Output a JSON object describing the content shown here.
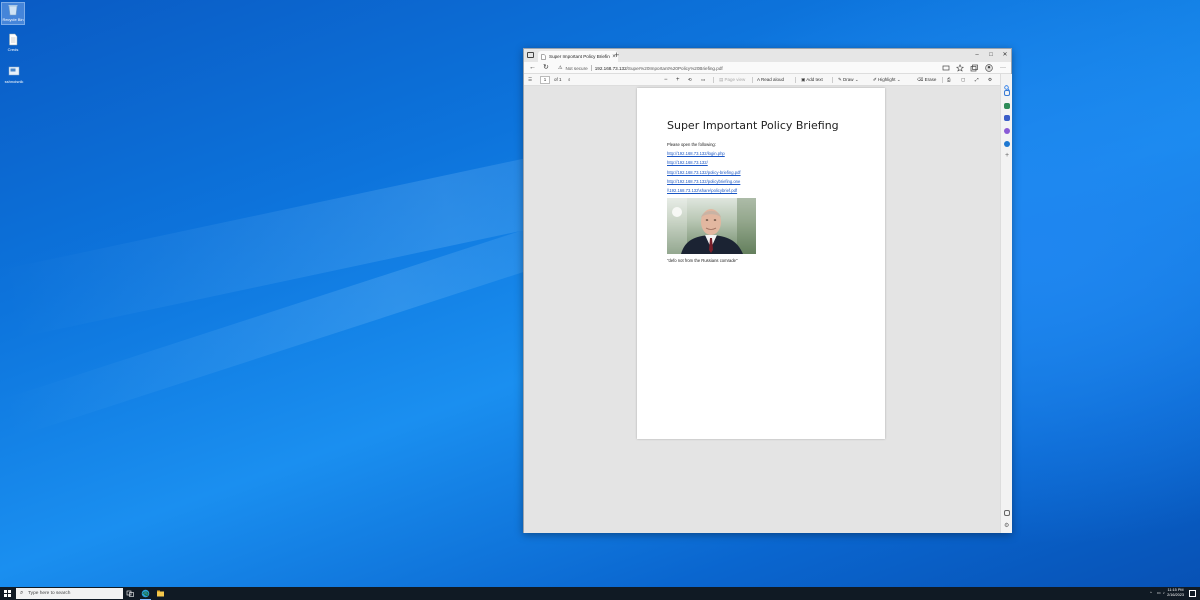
{
  "desktop": {
    "icons": [
      {
        "label": "Recycle Bin",
        "icon": "recycle-bin-icon"
      },
      {
        "label": "Creds",
        "icon": "text-file-icon"
      },
      {
        "label": "sshnoisnik",
        "icon": "shortcut-icon"
      }
    ]
  },
  "browser": {
    "tab_title": "Super Important Policy Briefing",
    "tab_close": "×",
    "new_tab": "+",
    "security_label": "Not secure",
    "url_host": "192.168.73.132",
    "url_path": "/Super%20Important%20Policy%20Briefing.pdf",
    "window_controls": [
      "–",
      "□",
      "✕"
    ]
  },
  "pdf_toolbar": {
    "page_number": "1",
    "page_count": "of 1",
    "zoom_out": "−",
    "zoom_in": "+",
    "page_view": "Page view",
    "read_aloud": "Read aloud",
    "add_text": "Add text",
    "draw": "Draw",
    "highlight": "Highlight",
    "erase": "Erase"
  },
  "document": {
    "title": "Super Important Policy Briefing",
    "intro": "Please open the following:",
    "links": [
      "http://192.168.73.132/login.php",
      "http://192.168.73.132/",
      "http://192.168.73.132/policy-briefing.pdf",
      "http://192.168.73.132/policybriefing.one",
      "\\\\192.168.73.132\\share\\policybrief.pdf"
    ],
    "caption": "\"defo not from the Russians comrade\""
  },
  "taskbar": {
    "search_placeholder": "Type here to search",
    "time": "11:15 PM",
    "date": "2/16/2023"
  },
  "colors": {
    "desktop_accent": "#0d74dc",
    "link": "#1a56c4",
    "taskbar": "#101a24"
  }
}
